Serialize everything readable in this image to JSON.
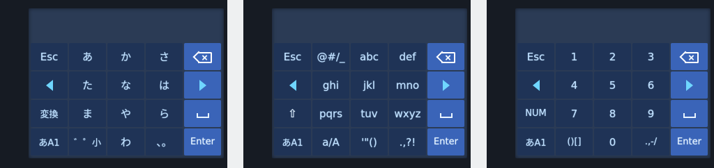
{
  "panels": [
    {
      "name": "kana",
      "keys": [
        [
          "Esc",
          "あ",
          "か",
          "さ",
          "[bksp]"
        ],
        [
          "[left]",
          "た",
          "な",
          "は",
          "[right]"
        ],
        [
          "変換",
          "ま",
          "や",
          "ら",
          "[space]"
        ],
        [
          "あA1",
          "゛゜小",
          "わ",
          "、。",
          "Enter"
        ]
      ]
    },
    {
      "name": "alpha",
      "keys": [
        [
          "Esc",
          "@#/_",
          "abc",
          "def",
          "[bksp]"
        ],
        [
          "[left]",
          "ghi",
          "jkl",
          "mno",
          "[right]"
        ],
        [
          "[shift]",
          "pqrs",
          "tuv",
          "wxyz",
          "[space]"
        ],
        [
          "あA1",
          "a/A",
          "'\"()",
          ".,?!",
          "Enter"
        ]
      ]
    },
    {
      "name": "numeric",
      "keys": [
        [
          "Esc",
          "1",
          "2",
          "3",
          "[bksp]"
        ],
        [
          "[left]",
          "4",
          "5",
          "6",
          "[right]"
        ],
        [
          "NUM",
          "7",
          "8",
          "9",
          "[space]"
        ],
        [
          "あA1",
          "()[]",
          "0",
          ".,-/",
          "Enter"
        ]
      ]
    }
  ],
  "icons": {
    "backspace": "backspace-icon",
    "left": "left-arrow-icon",
    "right": "right-arrow-icon",
    "space": "space-icon",
    "shift": "shift-icon"
  },
  "colors": {
    "screen": "#2b3b55",
    "key": "#1f3356",
    "side_key": "#3a64b8",
    "text": "#bfe0ff"
  }
}
